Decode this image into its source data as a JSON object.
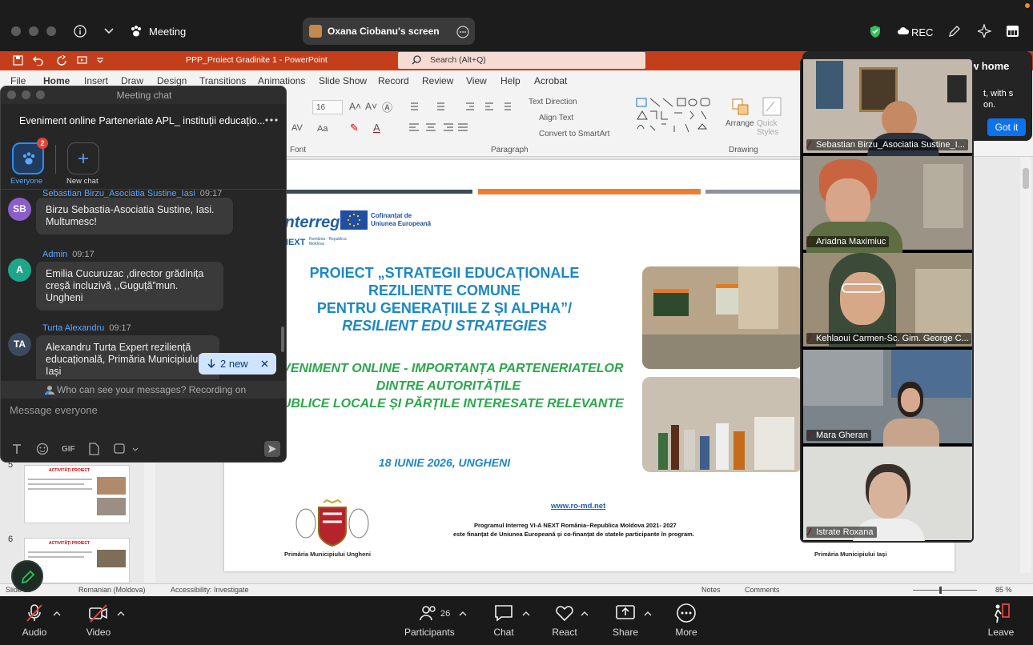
{
  "topbar": {
    "meeting_label": "Meeting",
    "share_label": "Oxana Ciobanu's screen",
    "rec_label": "REC"
  },
  "ppt": {
    "doc_title": "PPP_Proiect Gradinite 1  -  PowerPoint",
    "search_placeholder": "Search (Alt+Q)",
    "menu": [
      "File",
      "Home",
      "Insert",
      "Draw",
      "Design",
      "Transitions",
      "Animations",
      "Slide Show",
      "Record",
      "Review",
      "View",
      "Help",
      "Acrobat"
    ],
    "ribbon": {
      "font_size": "16",
      "font_group": "Font",
      "paragraph_group": "Paragraph",
      "drawing_group": "Drawing",
      "text_direction": "Text Direction",
      "align_text": "Align Text",
      "convert_smartart": "Convert to SmartArt",
      "arrange": "Arrange",
      "quick_styles": "Quick Styles"
    },
    "thumb_numbers": [
      "5",
      "6"
    ],
    "thumb_titles": [
      "ACTIVITĂȚI PROIECT",
      "ACTIVITĂȚI PROIECT"
    ],
    "status": {
      "slide": "Slide 13",
      "language": "Romanian (Moldova)",
      "accessibility": "Accessibility: Investigate",
      "notes": "Notes",
      "comments": "Comments",
      "zoom": "85 %"
    }
  },
  "slide": {
    "interreg": "Interreg",
    "eu_text": "Cofinanțat de Uniunea Europeană",
    "next_text": "NEXT",
    "next_sub": "România - Republica Moldova",
    "title_lines": [
      "PROIECT „STRATEGII EDUCAȚIONALE",
      "REZILIENTE COMUNE",
      "PENTRU GENERAȚIILE Z ȘI ALPHA”/"
    ],
    "title_en": "RESILIENT EDU STRATEGIES",
    "event_lines": [
      "EVENIMENT ONLINE - IMPORTANȚA PARTENERIATELOR",
      "DINTRE AUTORITĂȚILE",
      "PUBLICE LOCALE ȘI PĂRȚILE INTERESATE RELEVANTE"
    ],
    "date": "18 IUNIE 2026, UNGHENI",
    "website": "www.ro-md.net",
    "program_line1": "Programul Interreg VI-A NEXT România–Republica Moldova 2021- 2027",
    "program_line2": "este finanțat de Uniunea Europeană și co-finanțat de statele participante în program.",
    "left_logo_caption": "Primăria Municipiului Ungheni",
    "right_logo_caption": "Primăria Municipiului Iași"
  },
  "chat": {
    "window_title": "Meeting chat",
    "chat_name": "Eveniment online Parteneriate APL_ instituții educațio...",
    "everyone_label": "Everyone",
    "everyone_badge": "2",
    "new_chat_label": "New chat",
    "messages": [
      {
        "initials": "SB",
        "sender": "Sebastian Birzu_Asociatia Sustine_Iasi",
        "time": "09:17",
        "text": "Birzu Sebastia-Asociatia Sustine, Iasi. Multumesc!"
      },
      {
        "initials": "A",
        "sender": "Admin",
        "time": "09:17",
        "text": "Emilia Cucuruzac ,director grădinița creșă incluzivă ,,Guguță”mun. Ungheni"
      },
      {
        "initials": "TA",
        "sender": "Turta Alexandru",
        "time": "09:17",
        "text": "Alexandru Turta Expert reziliență educațională, Primăria Municipiului Iași"
      }
    ],
    "new_pill": "2 new",
    "privacy_note": "Who can see your messages? Recording on",
    "input_placeholder": "Message everyone",
    "gif_label": "GIF"
  },
  "popup": {
    "title": "w home",
    "body": "t, with s on.",
    "button": "Got it"
  },
  "participants": [
    {
      "name": "Sebastian Birzu_Asociatia Sustine_I...",
      "bg": "#b9b0a4"
    },
    {
      "name": "Ariadna Maximiuc",
      "bg": "#8a8478"
    },
    {
      "name": "Kehlaoui Carmen-Sc. Gim. George C...",
      "bg": "#a89b80"
    },
    {
      "name": "Mara Gheran",
      "bg": "#6f7a82"
    },
    {
      "name": "Istrate Roxana",
      "bg": "#d9d9d6"
    }
  ],
  "bottombar": {
    "audio": "Audio",
    "video": "Video",
    "participants": "Participants",
    "participant_count": "26",
    "chat": "Chat",
    "react": "React",
    "share": "Share",
    "more": "More",
    "leave": "Leave"
  },
  "colors": {
    "ppt_red": "#c43e1c",
    "slide_blue": "#1c88c4",
    "slide_green": "#2aa84a",
    "zoom_blue": "#0e72ed",
    "leave_red": "#e0463b"
  }
}
